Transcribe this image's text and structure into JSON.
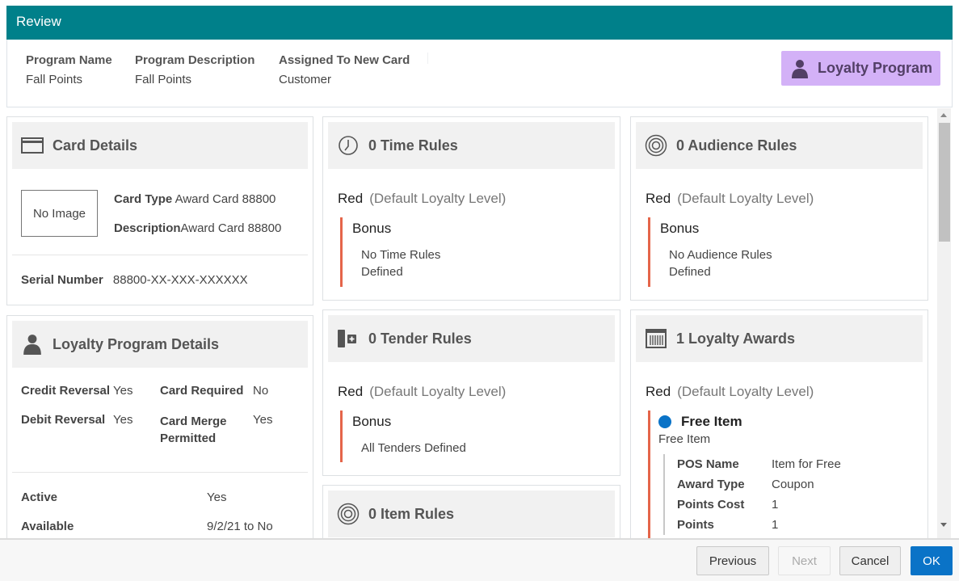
{
  "dialog": {
    "title": "Review"
  },
  "summary": {
    "columns": [
      {
        "label": "Program Name",
        "value": "Fall Points"
      },
      {
        "label": "Program Description",
        "value": "Fall Points"
      },
      {
        "label": "Assigned To New Card",
        "value": "Customer"
      }
    ],
    "badge": {
      "label": "Loyalty Program",
      "icon": "person-icon",
      "color": "#d3b1f7"
    }
  },
  "card_details": {
    "title": "Card Details",
    "icon": "credit-card-icon",
    "no_image": "No Image",
    "fields": [
      {
        "label": "Card Type",
        "value": "Award Card 88800"
      },
      {
        "label": "Description",
        "value": "Award Card 88800"
      }
    ],
    "serial": {
      "label": "Serial Number",
      "value": "88800-XX-XXX-XXXXXX"
    }
  },
  "loyalty_details": {
    "title": "Loyalty Program Details",
    "icon": "person-icon",
    "left_fields": [
      {
        "label": "Credit Reversal",
        "value": "Yes"
      },
      {
        "label": "Debit Reversal",
        "value": "Yes"
      }
    ],
    "right_fields": [
      {
        "label": "Card Required",
        "value": "No"
      },
      {
        "label": "Card Merge Permitted",
        "value": "Yes"
      }
    ],
    "status_fields": [
      {
        "label": "Active",
        "value": "Yes"
      },
      {
        "label": "Available",
        "value": "9/2/21 to No"
      }
    ]
  },
  "time_rules": {
    "title": "0 Time Rules",
    "icon": "clock-icon",
    "level": "Red",
    "level_note": "(Default Loyalty Level)",
    "bonus_title": "Bonus",
    "bonus_text_1": "No Time Rules",
    "bonus_text_2": "Defined"
  },
  "tender_rules": {
    "title": "0 Tender Rules",
    "icon": "tender-add-icon",
    "level": "Red",
    "level_note": "(Default Loyalty Level)",
    "bonus_title": "Bonus",
    "bonus_text_1": "All Tenders Defined"
  },
  "item_rules": {
    "title": "0 Item Rules",
    "icon": "target-icon"
  },
  "audience_rules": {
    "title": "0 Audience Rules",
    "icon": "target-icon",
    "level": "Red",
    "level_note": "(Default Loyalty Level)",
    "bonus_title": "Bonus",
    "bonus_text_1": "No Audience Rules",
    "bonus_text_2": "Defined"
  },
  "loyalty_awards": {
    "title": "1 Loyalty Awards",
    "icon": "barcode-icon",
    "level": "Red",
    "level_note": "(Default Loyalty Level)",
    "award": {
      "name": "Free Item",
      "subtitle": "Free Item",
      "status_color": "#0a73c7",
      "fields": [
        {
          "label": "POS Name",
          "value": "Item for Free"
        },
        {
          "label": "Award Type",
          "value": "Coupon"
        },
        {
          "label": "Points Cost",
          "value": "1"
        },
        {
          "label": "Points",
          "value": "1"
        }
      ]
    }
  },
  "colors": {
    "header": "#00808a",
    "accent_bar": "#e5654a",
    "primary": "#0a73c7"
  },
  "footer": {
    "previous": "Previous",
    "next": "Next",
    "cancel": "Cancel",
    "ok": "OK"
  }
}
